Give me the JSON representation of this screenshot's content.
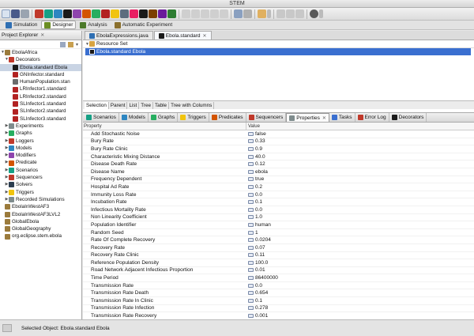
{
  "window": {
    "title": "STEM"
  },
  "perspectives": [
    {
      "label": "Simulation",
      "color": "#2f6fb3",
      "active": false
    },
    {
      "label": "Designer",
      "color": "#6b8e23",
      "active": true
    },
    {
      "label": "Analysis",
      "color": "#4c7a2a",
      "active": false
    },
    {
      "label": "Automatic Experiment",
      "color": "#8a6f2d",
      "active": false
    }
  ],
  "explorer": {
    "title": "Project Explorer",
    "tree": [
      {
        "label": "EbolaAfrica",
        "depth": 0,
        "twisty": "▼",
        "icon_color": "#9b7b3c",
        "selected": false
      },
      {
        "label": "Decorators",
        "depth": 1,
        "twisty": "▼",
        "icon_color": "#c0392b",
        "selected": false
      },
      {
        "label": "Ebola.standard Ebola",
        "depth": 2,
        "twisty": "",
        "icon_color": "#1a1a1a",
        "selected": true
      },
      {
        "label": "GNInfector.standard",
        "depth": 2,
        "twisty": "",
        "icon_color": "#b22222",
        "selected": false
      },
      {
        "label": "HumanPopulation.stan",
        "depth": 2,
        "twisty": "",
        "icon_color": "#6b6b6b",
        "selected": false
      },
      {
        "label": "LRInfector1.standard",
        "depth": 2,
        "twisty": "",
        "icon_color": "#b22222",
        "selected": false
      },
      {
        "label": "LRInfector2.standard",
        "depth": 2,
        "twisty": "",
        "icon_color": "#b22222",
        "selected": false
      },
      {
        "label": "SLInfector1.standard",
        "depth": 2,
        "twisty": "",
        "icon_color": "#b22222",
        "selected": false
      },
      {
        "label": "SLInfector2.standard",
        "depth": 2,
        "twisty": "",
        "icon_color": "#b22222",
        "selected": false
      },
      {
        "label": "SLInfector3.standard",
        "depth": 2,
        "twisty": "",
        "icon_color": "#b22222",
        "selected": false
      },
      {
        "label": "Experiments",
        "depth": 1,
        "twisty": "▶",
        "icon_color": "#7f8c8d",
        "selected": false
      },
      {
        "label": "Graphs",
        "depth": 1,
        "twisty": "▶",
        "icon_color": "#27ae60",
        "selected": false
      },
      {
        "label": "Loggers",
        "depth": 1,
        "twisty": "▶",
        "icon_color": "#c0392b",
        "selected": false
      },
      {
        "label": "Models",
        "depth": 1,
        "twisty": "▶",
        "icon_color": "#2e86c1",
        "selected": false
      },
      {
        "label": "Modifiers",
        "depth": 1,
        "twisty": "▶",
        "icon_color": "#8e44ad",
        "selected": false
      },
      {
        "label": "Predicate",
        "depth": 1,
        "twisty": "▶",
        "icon_color": "#d35400",
        "selected": false
      },
      {
        "label": "Scenarios",
        "depth": 1,
        "twisty": "▶",
        "icon_color": "#16a085",
        "selected": false
      },
      {
        "label": "Sequencers",
        "depth": 1,
        "twisty": "▶",
        "icon_color": "#c0392b",
        "selected": false
      },
      {
        "label": "Solvers",
        "depth": 1,
        "twisty": "▶",
        "icon_color": "#2c3e50",
        "selected": false
      },
      {
        "label": "Triggers",
        "depth": 1,
        "twisty": "▶",
        "icon_color": "#f1c40f",
        "selected": false
      },
      {
        "label": "Recorded Simulations",
        "depth": 1,
        "twisty": "▶",
        "icon_color": "#7f8c8d",
        "selected": false
      },
      {
        "label": "EbolaInWestAF3",
        "depth": 0,
        "twisty": "",
        "icon_color": "#9b7b3c",
        "selected": false
      },
      {
        "label": "EbolaInWestAF3LVL2",
        "depth": 0,
        "twisty": "",
        "icon_color": "#9b7b3c",
        "selected": false
      },
      {
        "label": "GlobalEbola",
        "depth": 0,
        "twisty": "",
        "icon_color": "#9b7b3c",
        "selected": false
      },
      {
        "label": "GlobalGeography",
        "depth": 0,
        "twisty": "",
        "icon_color": "#9b7b3c",
        "selected": false
      },
      {
        "label": "org.eclipse.stem.ebola",
        "depth": 0,
        "twisty": "",
        "icon_color": "#9b7b3c",
        "selected": false
      }
    ]
  },
  "editor": {
    "tabs": [
      {
        "label": "EbolaExpressions.java",
        "active": false
      },
      {
        "label": "Ebola.standard",
        "active": true
      }
    ],
    "resource_set_label": "Resource Set",
    "selected_resource": "Ebola.standard Ebola",
    "bottom_tabs": [
      "Selection",
      "Parent",
      "List",
      "Tree",
      "Table",
      "Tree with Columns"
    ]
  },
  "properties_tabs": [
    {
      "label": "Scenarios",
      "color": "#16a085",
      "active": false
    },
    {
      "label": "Models",
      "color": "#2e86c1",
      "active": false
    },
    {
      "label": "Graphs",
      "color": "#27ae60",
      "active": false
    },
    {
      "label": "Triggers",
      "color": "#f1c40f",
      "active": false
    },
    {
      "label": "Predicates",
      "color": "#d35400",
      "active": false
    },
    {
      "label": "Sequencers",
      "color": "#c0392b",
      "active": false
    },
    {
      "label": "Properties",
      "color": "#7f8c8d",
      "active": true
    },
    {
      "label": "Tasks",
      "color": "#3a6fd0",
      "active": false
    },
    {
      "label": "Error Log",
      "color": "#c0392b",
      "active": false
    },
    {
      "label": "Decorators",
      "color": "#1a1a1a",
      "active": false
    }
  ],
  "properties": {
    "col_property": "Property",
    "col_value": "Value",
    "rows": [
      {
        "name": "Add Stochastic Noise",
        "value": "false"
      },
      {
        "name": "Bury Rate",
        "value": "0.33"
      },
      {
        "name": "Bury Rate Clinic",
        "value": "0.9"
      },
      {
        "name": "Characteristic Mixing Distance",
        "value": "40.0"
      },
      {
        "name": "Disease Death Rate",
        "value": "0.12"
      },
      {
        "name": "Disease Name",
        "value": "ebola"
      },
      {
        "name": "Frequency Dependent",
        "value": "true"
      },
      {
        "name": "Hospital Ad Rate",
        "value": "0.2"
      },
      {
        "name": "Immunity Loss Rate",
        "value": "0.0"
      },
      {
        "name": "Incubation Rate",
        "value": "0.1"
      },
      {
        "name": "Infectious Mortality Rate",
        "value": "0.0"
      },
      {
        "name": "Non Linearity Coefficient",
        "value": "1.0"
      },
      {
        "name": "Population Identifier",
        "value": "human"
      },
      {
        "name": "Random Seed",
        "value": "1"
      },
      {
        "name": "Rate Of Complete Recovery",
        "value": "0.0204"
      },
      {
        "name": "Recovery Rate",
        "value": "0.07"
      },
      {
        "name": "Recovery Rate Clinic",
        "value": "0.11"
      },
      {
        "name": "Reference Population Density",
        "value": "100.0"
      },
      {
        "name": "Road Network Adjacent Infectious Proportion",
        "value": "0.01"
      },
      {
        "name": "Time Period",
        "value": "86400000"
      },
      {
        "name": "Transmission Rate",
        "value": "0.0"
      },
      {
        "name": "Transmission Rate Death",
        "value": "0.654"
      },
      {
        "name": "Transmission Rate In Clinic",
        "value": "0.1"
      },
      {
        "name": "Transmission Rate Infection",
        "value": "0.278"
      },
      {
        "name": "Transmission Rate Recovery",
        "value": "0.001"
      }
    ]
  },
  "status": {
    "text": "Selected Object: Ebola.standard Ebola"
  }
}
